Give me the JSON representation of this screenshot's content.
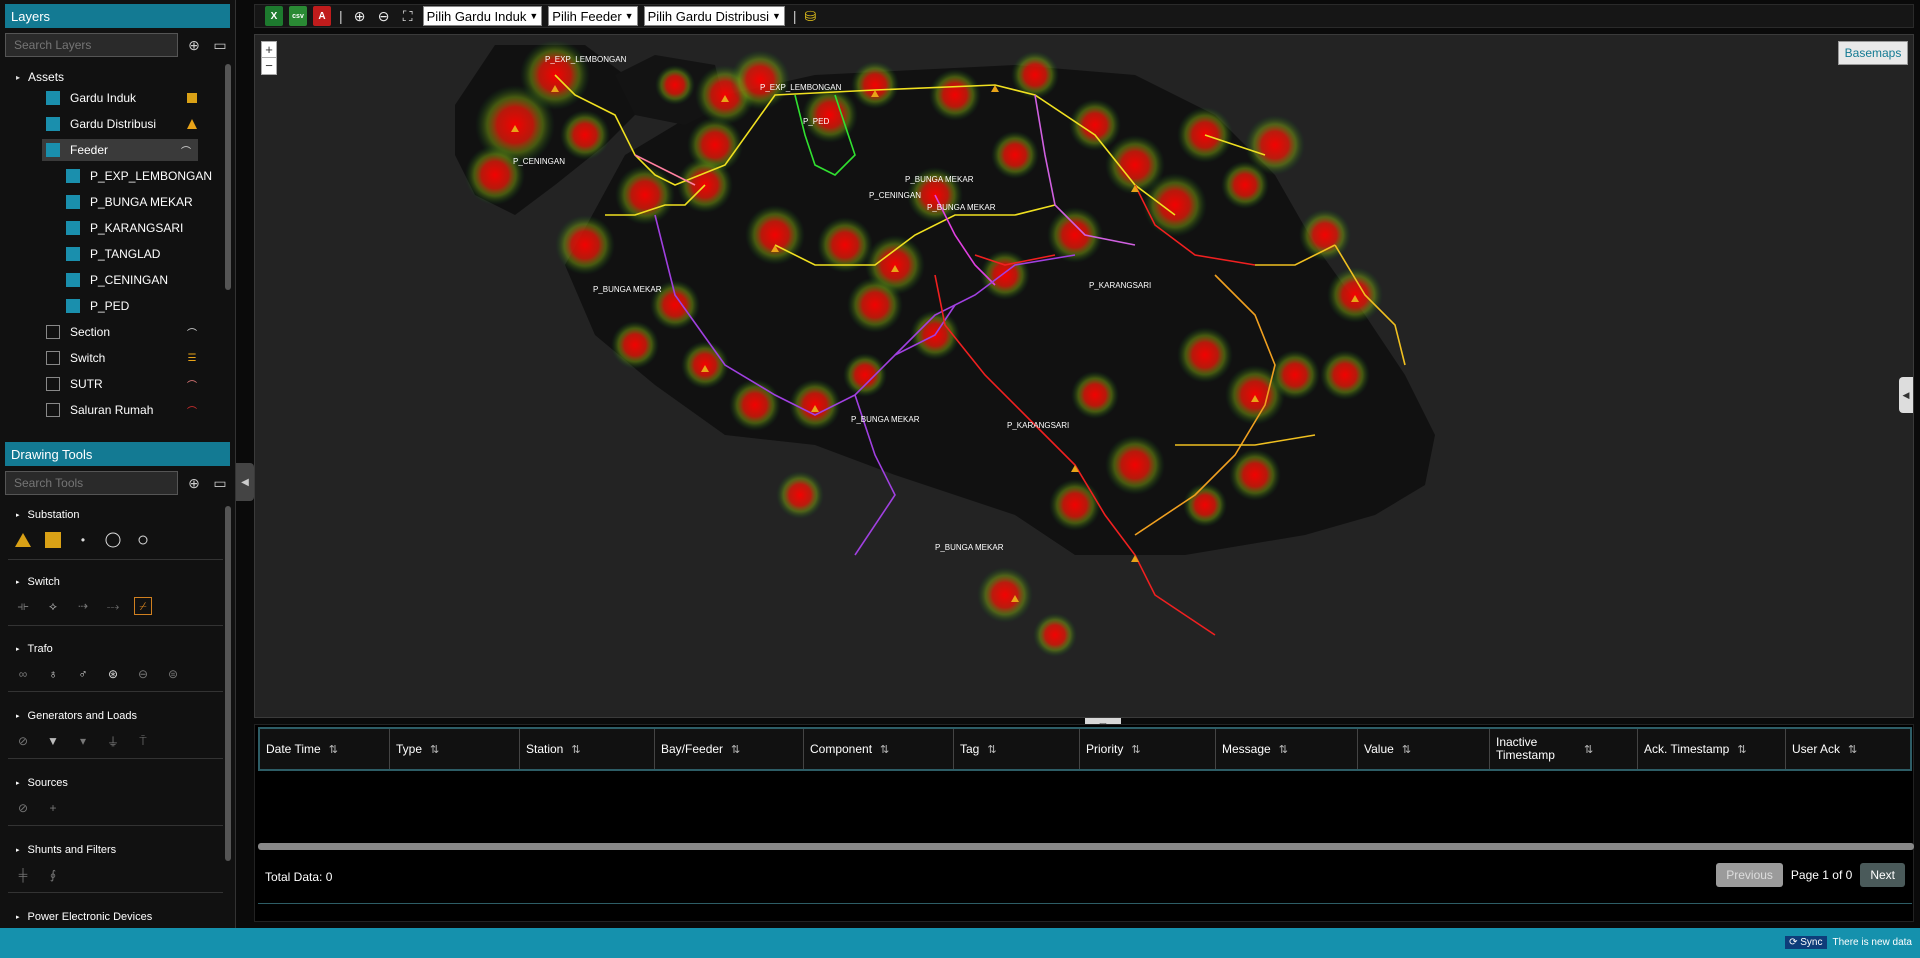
{
  "layers": {
    "header": "Layers",
    "search_placeholder": "Search Layers",
    "items": [
      {
        "label": "Assets",
        "group": true
      },
      {
        "label": "Gardu Induk",
        "checked": true,
        "icon": "square-icon"
      },
      {
        "label": "Gardu Distribusi",
        "checked": true,
        "icon": "triangle-icon"
      },
      {
        "label": "Feeder",
        "checked": true,
        "icon": "line-icon",
        "selected": true
      },
      {
        "label": "P_EXP_LEMBONGAN",
        "checked": true
      },
      {
        "label": "P_BUNGA MEKAR",
        "checked": true
      },
      {
        "label": "P_KARANGSARI",
        "checked": true
      },
      {
        "label": "P_TANGLAD",
        "checked": true
      },
      {
        "label": "P_CENINGAN",
        "checked": true
      },
      {
        "label": "P_PED",
        "checked": true
      },
      {
        "label": "Section",
        "checked": false,
        "icon": "line-icon"
      },
      {
        "label": "Switch",
        "checked": false,
        "icon": "switch-icon"
      },
      {
        "label": "SUTR",
        "checked": false,
        "icon": "line-icon"
      },
      {
        "label": "Saluran Rumah",
        "checked": false,
        "icon": "line-icon"
      }
    ]
  },
  "drawing_tools": {
    "header": "Drawing Tools",
    "search_placeholder": "Search Tools",
    "groups": [
      {
        "label": "Substation"
      },
      {
        "label": "Switch"
      },
      {
        "label": "Trafo"
      },
      {
        "label": "Generators and Loads"
      },
      {
        "label": "Sources"
      },
      {
        "label": "Shunts and Filters"
      },
      {
        "label": "Power Electronic Devices"
      }
    ]
  },
  "toolbar": {
    "excel_label": "X",
    "csv_label": "csv",
    "pdf_label": "A",
    "select_gardu_induk": "Pilih Gardu Induk",
    "select_feeder": "Pilih Feeder",
    "select_gardu_distribusi": "Pilih Gardu Distribusi"
  },
  "map": {
    "zoom_in": "+",
    "zoom_out": "−",
    "basemaps_label": "Basemaps",
    "labels": [
      "P_EXP_LEMBONGAN",
      "P_EXP_LEMBONGAN",
      "P_CENINGAN",
      "P_PED",
      "P_BUNGA MEKAR",
      "P_CENINGAN",
      "P_BUNGA MEKAR",
      "P_BUNGA MEKAR",
      "P_KARANGSARI",
      "P_BUNGA MEKAR",
      "P_KARANGSARI",
      "P_BUNGA MEKAR"
    ]
  },
  "table": {
    "columns": [
      "Date Time",
      "Type",
      "Station",
      "Bay/Feeder",
      "Component",
      "Tag",
      "Priority",
      "Message",
      "Value",
      "Inactive Timestamp",
      "Ack. Timestamp",
      "User Ack"
    ],
    "total_label": "Total Data: 0",
    "prev_label": "Previous",
    "page_info": "Page 1 of 0",
    "next_label": "Next"
  },
  "status": {
    "sync_label": "Sync",
    "message": "There is new data"
  }
}
